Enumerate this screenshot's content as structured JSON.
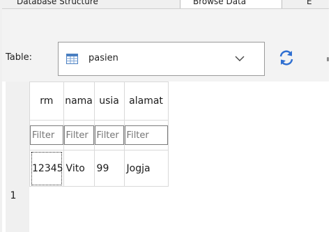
{
  "tabs": {
    "database_structure": "Database Structure",
    "browse_data": "Browse Data",
    "edit": "E"
  },
  "toolbar": {
    "table_label": "Table:",
    "table_select_value": "pasien",
    "table_icon": "table-icon",
    "dropdown_icon": "chevron-down-icon",
    "refresh_icon": "refresh-icon"
  },
  "grid": {
    "columns": [
      "rm",
      "nama",
      "usia",
      "alamat"
    ],
    "filter_placeholder": "Filter",
    "rows": [
      {
        "rownum": "1",
        "cells": [
          "12345",
          "Vito",
          "99",
          "Jogja"
        ]
      }
    ],
    "selected_cell_color": "#222222"
  },
  "colors": {
    "toolbar_bg": "#f3f3f3",
    "grid_line": "#d9d9d9",
    "refresh_blue": "#2f6fd1"
  }
}
